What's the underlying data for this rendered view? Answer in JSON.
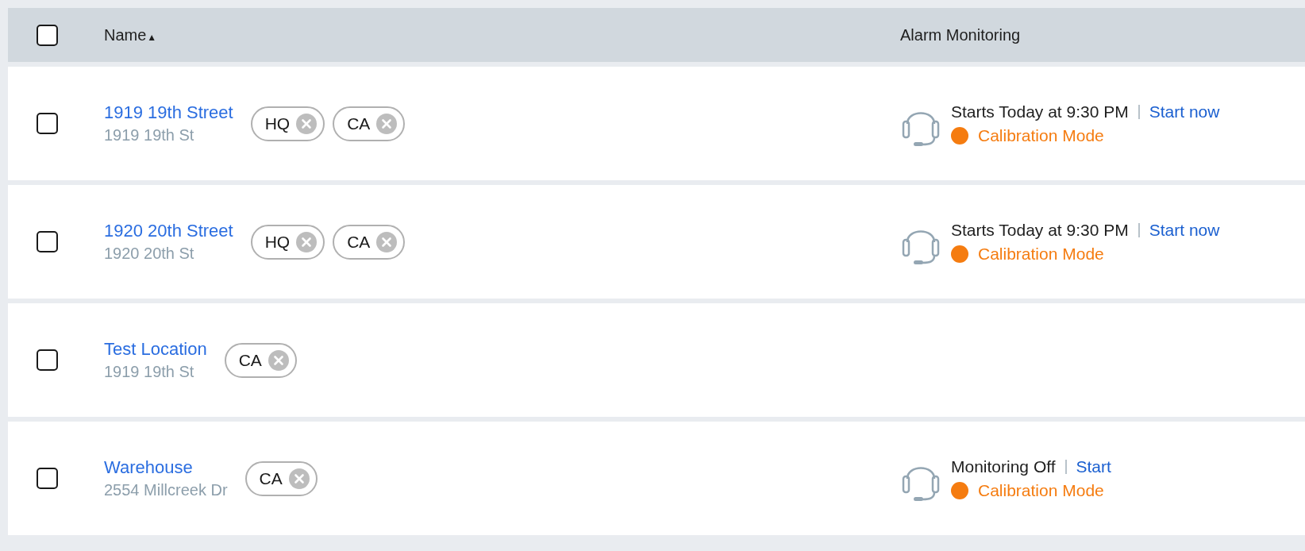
{
  "header": {
    "checked": false,
    "columns": [
      {
        "label": "Name",
        "sort_icon": "▲"
      },
      {
        "label": "Alarm Monitoring"
      }
    ]
  },
  "rows": [
    {
      "checked": false,
      "name": "1919 19th Street",
      "address": "1919 19th St",
      "tags": [
        {
          "label": "HQ"
        },
        {
          "label": "CA"
        }
      ],
      "alarm": {
        "status": "Starts Today at 9:30 PM",
        "action": "Start now",
        "mode": "Calibration Mode",
        "color": "#f57c10"
      }
    },
    {
      "checked": false,
      "name": "1920 20th Street",
      "address": "1920 20th St",
      "tags": [
        {
          "label": "HQ"
        },
        {
          "label": "CA"
        }
      ],
      "alarm": {
        "status": "Starts Today at 9:30 PM",
        "action": "Start now",
        "mode": "Calibration Mode",
        "color": "#f57c10"
      }
    },
    {
      "checked": false,
      "name": "Test Location",
      "address": "1919 19th St",
      "tags": [
        {
          "label": "CA"
        }
      ]
    },
    {
      "checked": false,
      "name": "Warehouse",
      "address": "2554 Millcreek Dr",
      "tags": [
        {
          "label": "CA"
        }
      ],
      "alarm": {
        "status": "Monitoring Off",
        "action": "Start",
        "mode": "Calibration Mode",
        "color": "#f57c10"
      }
    }
  ]
}
